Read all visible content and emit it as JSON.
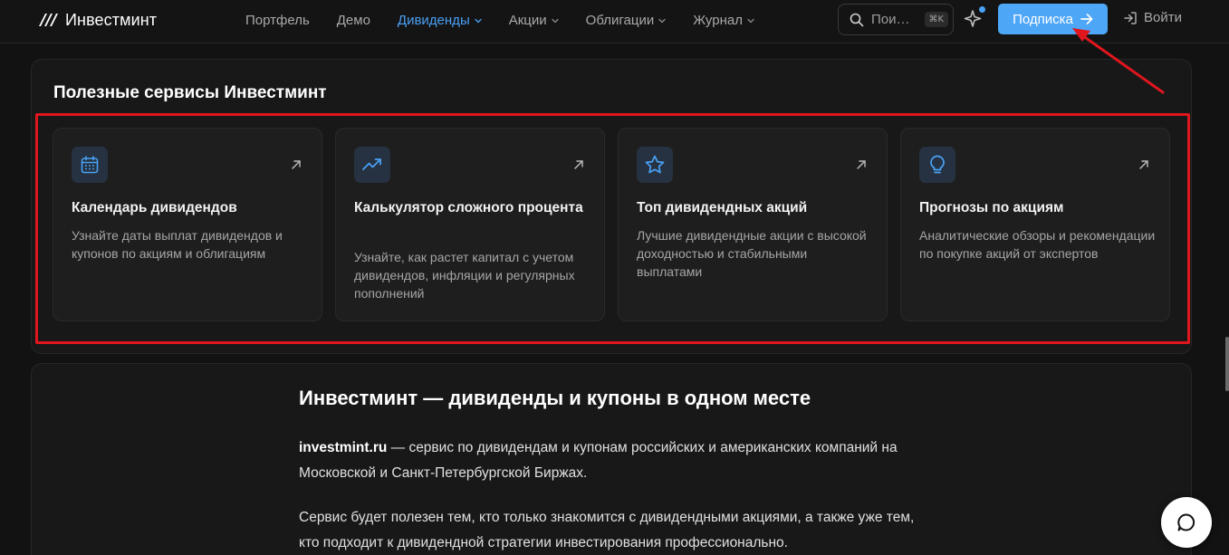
{
  "header": {
    "logo_text": "Инвестминт",
    "nav": [
      {
        "label": "Портфель",
        "dropdown": false,
        "active": false
      },
      {
        "label": "Демо",
        "dropdown": false,
        "active": false
      },
      {
        "label": "Дивиденды",
        "dropdown": true,
        "active": true
      },
      {
        "label": "Акции",
        "dropdown": true,
        "active": false
      },
      {
        "label": "Облигации",
        "dropdown": true,
        "active": false
      },
      {
        "label": "Журнал",
        "dropdown": true,
        "active": false
      }
    ],
    "search_placeholder": "Пои…",
    "search_shortcut": "⌘K",
    "subscribe_label": "Подписка",
    "login_label": "Войти"
  },
  "services": {
    "title": "Полезные сервисы Инвестминт",
    "cards": [
      {
        "icon": "calendar-icon",
        "title": "Календарь дивидендов",
        "description": "Узнайте даты выплат дивидендов и купонов по акциям и облигациям"
      },
      {
        "icon": "trending-up-icon",
        "title": "Калькулятор сложного процента",
        "description": "Узнайте, как растет капитал с учетом дивидендов, инфляции и регулярных пополнений"
      },
      {
        "icon": "star-icon",
        "title": "Топ дивидендных акций",
        "description": "Лучшие дивидендные акции с высокой доходностью и стабильными выплатами"
      },
      {
        "icon": "lightbulb-icon",
        "title": "Прогнозы по акциям",
        "description": "Аналитические обзоры и рекомендации по покупке акций от экспертов"
      }
    ]
  },
  "about": {
    "title": "Инвестминт — дивиденды и купоны в одном месте",
    "p1_strong": "investmint.ru",
    "p1_rest": " — сервис по дивидендам и купонам российских и американских компаний на Московской и Санкт-Петербургской Биржах.",
    "p2": "Сервис будет полезен тем, кто только знакомится с дивидендными акциями, а также уже тем, кто подходит к дивидендной стратегии инвестирования профессионально."
  },
  "colors": {
    "accent": "#4aa1f5",
    "annotation": "#e0161e",
    "background": "#121212"
  }
}
